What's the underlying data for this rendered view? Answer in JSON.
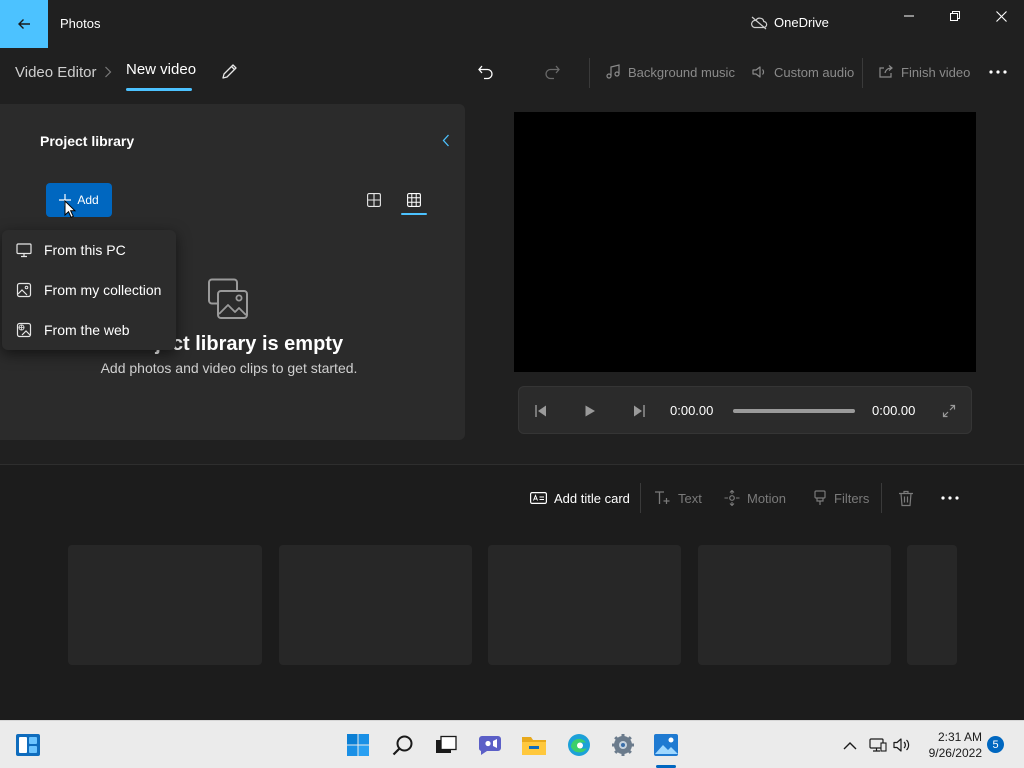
{
  "app": {
    "title": "Photos",
    "onedrive_label": "OneDrive"
  },
  "breadcrumb": {
    "root": "Video Editor",
    "current": "New video"
  },
  "toolbar": {
    "background_music": "Background music",
    "custom_audio": "Custom audio",
    "finish_video": "Finish video"
  },
  "library": {
    "title": "Project library",
    "add_label": "Add",
    "empty_title": "Project library is empty",
    "empty_subtitle": "Add photos and video clips to get started."
  },
  "add_menu": {
    "items": [
      {
        "label": "From this PC",
        "icon": "monitor-icon"
      },
      {
        "label": "From my collection",
        "icon": "image-icon"
      },
      {
        "label": "From the web",
        "icon": "web-image-icon"
      }
    ]
  },
  "player": {
    "current_time": "0:00.00",
    "total_time": "0:00.00",
    "progress": 0
  },
  "storyboard": {
    "add_title_card": "Add title card",
    "text": "Text",
    "motion": "Motion",
    "filters": "Filters",
    "placeholder_cards": 5
  },
  "taskbar": {
    "time": "2:31 AM",
    "date": "9/26/2022",
    "notification_count": "5",
    "apps": [
      "widgets-icon",
      "start-icon",
      "search-icon",
      "task-view-icon",
      "chat-icon",
      "file-explorer-icon",
      "edge-icon",
      "settings-icon",
      "photos-icon"
    ]
  },
  "colors": {
    "accent": "#4cc2ff",
    "button_blue": "#0067c0",
    "background": "#202020",
    "panel": "#2b2b2b"
  }
}
